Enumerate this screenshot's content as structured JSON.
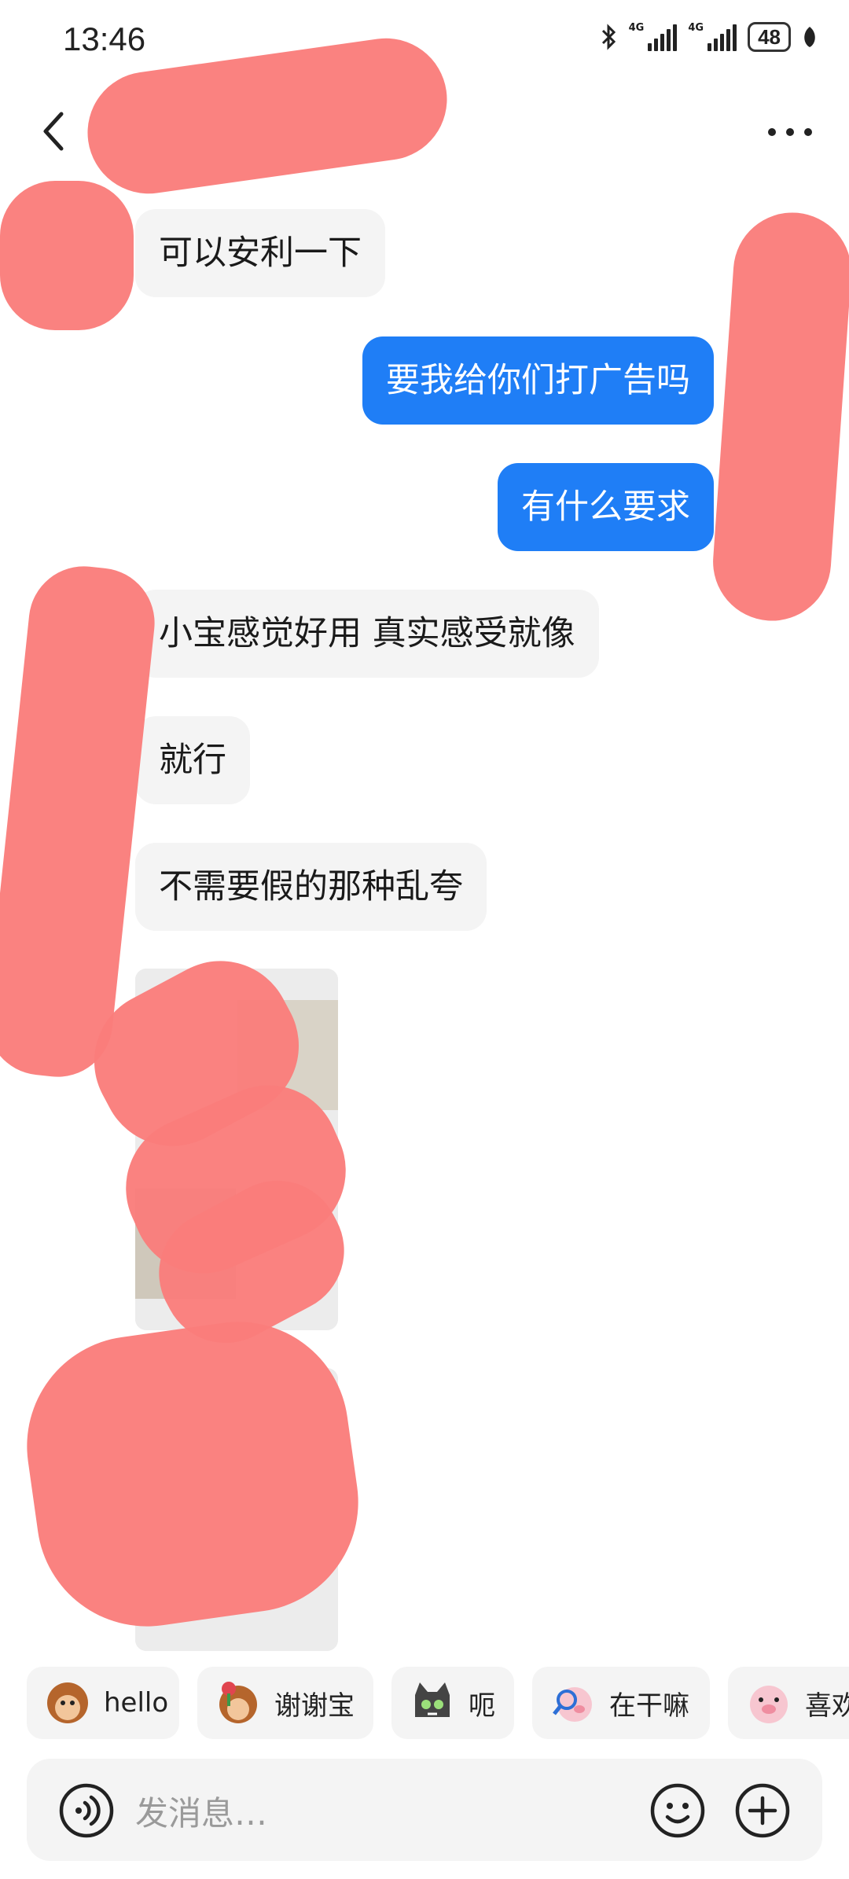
{
  "status_bar": {
    "time": "13:46",
    "network_1": "4G",
    "network_2": "4G",
    "battery": "48",
    "icons": [
      "bluetooth-icon",
      "signal-icon",
      "battery-icon",
      "leaf-icon"
    ]
  },
  "header": {
    "contact_name": "",
    "icons": [
      "back-icon",
      "more-icon"
    ]
  },
  "messages": [
    {
      "side": "in",
      "text": "可以安利一下"
    },
    {
      "side": "out",
      "text": "要我给你们打广告吗"
    },
    {
      "side": "out",
      "text": "有什么要求"
    },
    {
      "side": "in",
      "text": "小宝感觉好用 真实感受就像"
    },
    {
      "side": "in",
      "text": "就行"
    },
    {
      "side": "in",
      "text": "不需要假的那种乱夸"
    },
    {
      "side": "in",
      "type": "image"
    },
    {
      "side": "in",
      "type": "image"
    }
  ],
  "quick_replies": [
    {
      "label": "hello",
      "icon": "monkey-sticker-icon"
    },
    {
      "label": "谢谢宝",
      "icon": "monkey-flower-sticker-icon"
    },
    {
      "label": "呃",
      "icon": "cat-sticker-icon"
    },
    {
      "label": "在干嘛",
      "icon": "pig-magnifier-sticker-icon"
    },
    {
      "label": "喜欢",
      "icon": "pig-sticker-icon"
    }
  ],
  "input": {
    "placeholder": "发消息…",
    "icons": [
      "voice-icon",
      "emoji-icon",
      "plus-icon"
    ]
  },
  "colors": {
    "outgoing_bubble": "#1f7ef6",
    "incoming_bubble": "#f4f4f4",
    "redaction": "#fa7d7b"
  }
}
